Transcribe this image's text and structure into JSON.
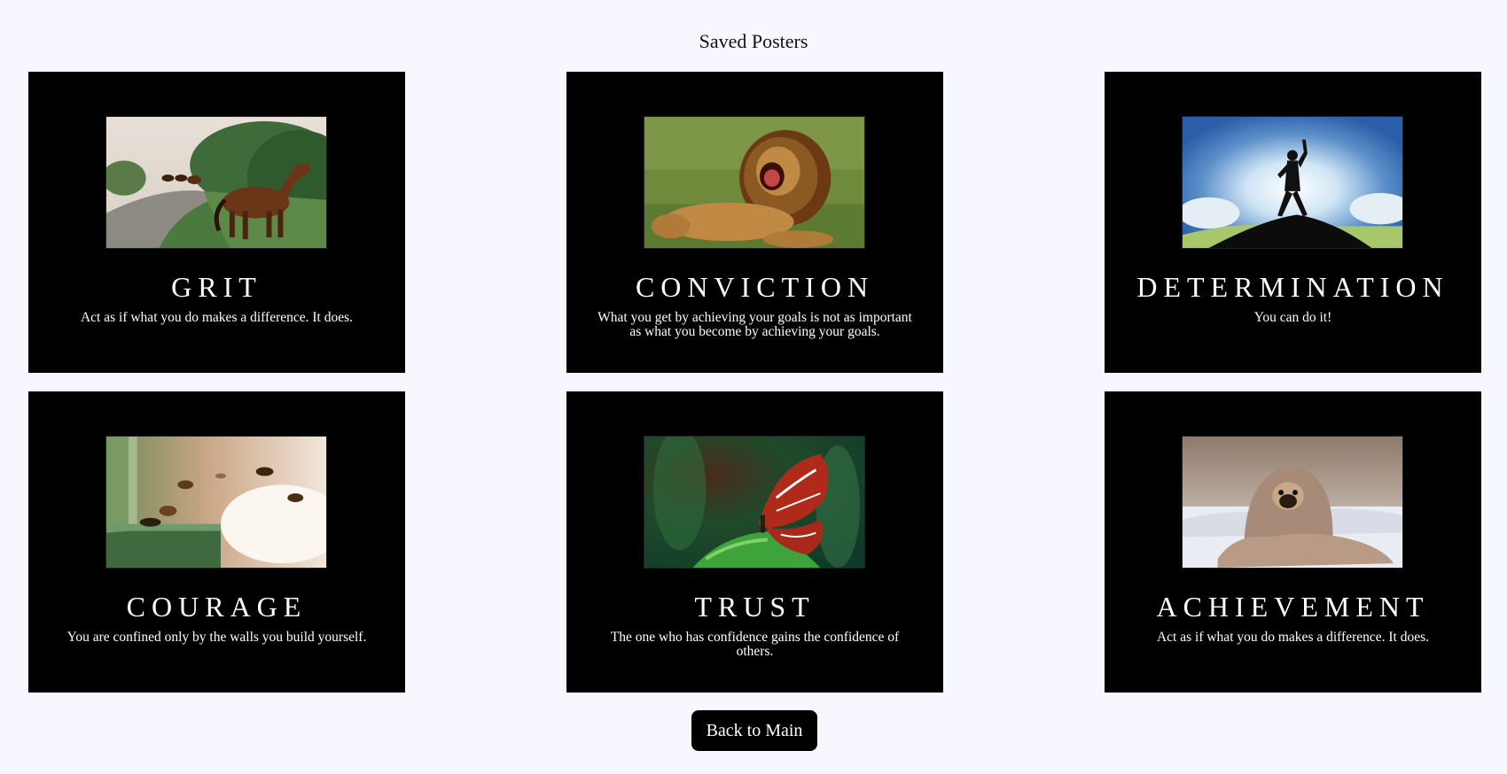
{
  "page": {
    "title": "Saved Posters",
    "back_button_label": "Back to Main"
  },
  "posters": [
    {
      "title": "GRIT",
      "quote": "Act as if what you do makes a difference. It does.",
      "image_icon": "horses-photo"
    },
    {
      "title": "CONVICTION",
      "quote": "What you get by achieving your goals is not as important as what you become by achieving your goals.",
      "image_icon": "lion-roaring-photo"
    },
    {
      "title": "DETERMINATION",
      "quote": "You can do it!",
      "image_icon": "mountain-summit-silhouette-photo"
    },
    {
      "title": "COURAGE",
      "quote": "You are confined only by the walls you build yourself.",
      "image_icon": "bees-hive-photo"
    },
    {
      "title": "TRUST",
      "quote": "The one who has confidence gains the confidence of others.",
      "image_icon": "butterfly-on-fern-photo"
    },
    {
      "title": "ACHIEVEMENT",
      "quote": "Act as if what you do makes a difference. It does.",
      "image_icon": "pug-in-blanket-photo"
    }
  ],
  "colors": {
    "page_background": "#f7f8ff",
    "poster_background": "#000000",
    "poster_text": "#ffffff",
    "button_background": "#000000"
  }
}
